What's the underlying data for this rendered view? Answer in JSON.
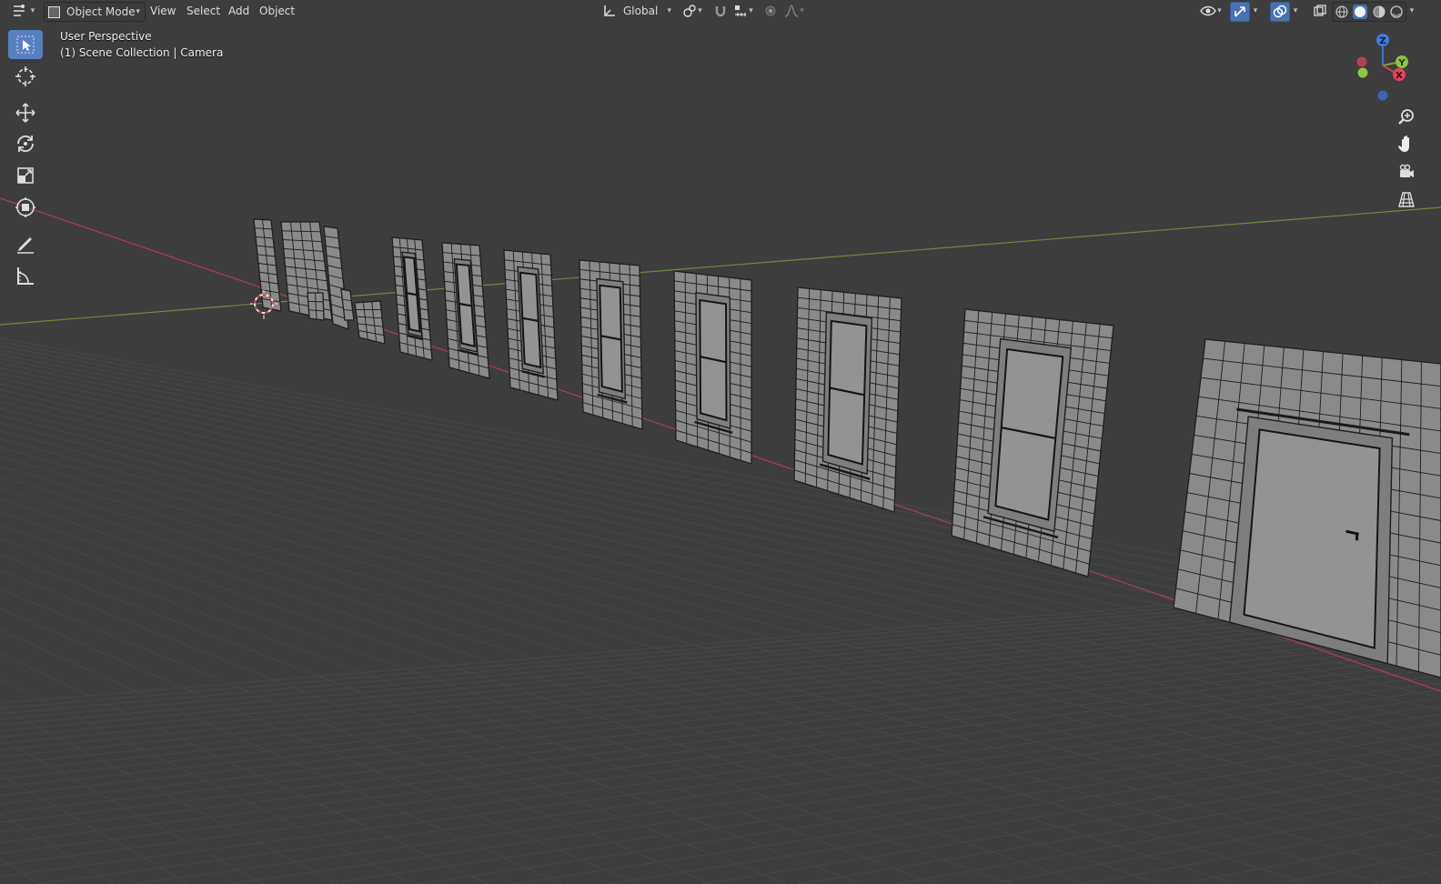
{
  "header": {
    "editor_icon": "editor-type-icon",
    "mode_label": "Object Mode",
    "menu": [
      "View",
      "Select",
      "Add",
      "Object"
    ],
    "orientation_label": "Global"
  },
  "overlay": {
    "view_name": "User Perspective",
    "collection": "(1) Scene Collection | Camera"
  },
  "toolbar": {
    "tools": [
      "select-box-icon",
      "cursor-icon",
      "move-icon",
      "rotate-icon",
      "scale-icon",
      "transform-icon",
      "annotate-icon",
      "measure-icon"
    ],
    "active": "select-box-icon"
  },
  "gizmo": {
    "x": "X",
    "y": "Y",
    "z": "Z"
  },
  "colors": {
    "background": "#3d3d3d",
    "grid": "#474747",
    "x_axis": "#a8434e",
    "y_axis": "#6b8b3a",
    "mesh_fill": "#8a8a8a",
    "wire": "#1e1e1e",
    "accent": "#4772b3"
  }
}
